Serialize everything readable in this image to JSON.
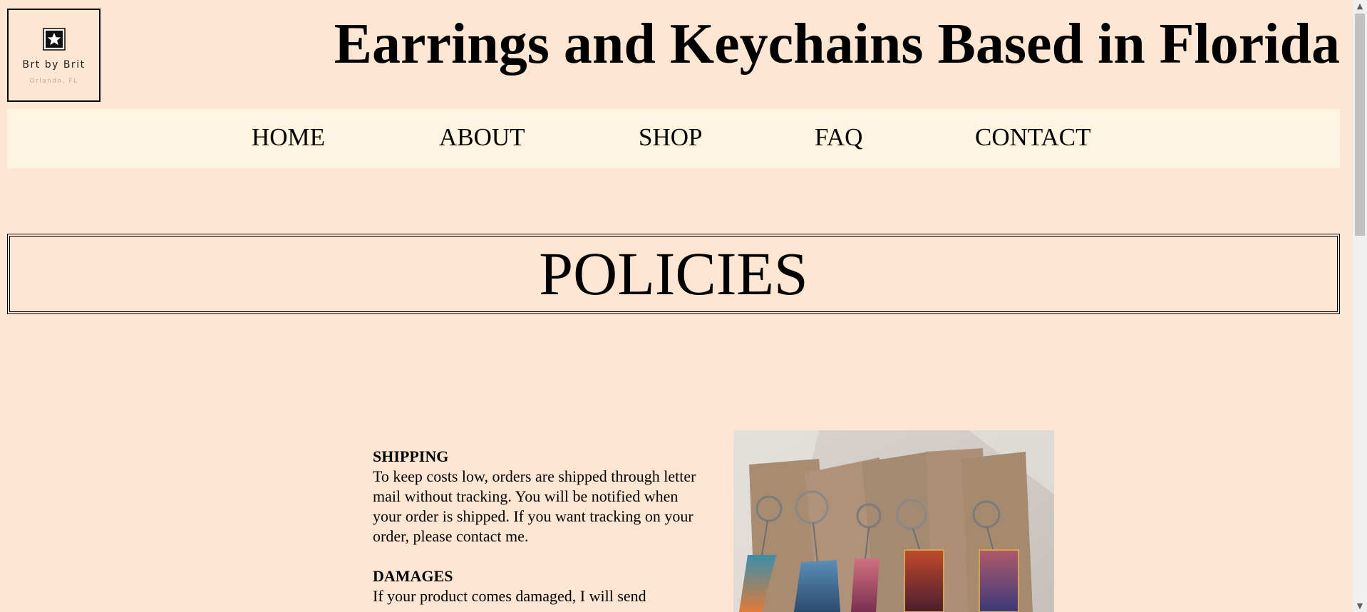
{
  "header": {
    "logo": {
      "name": "Brt by Brit",
      "location": "Orlando, FL",
      "icon": "star-icon"
    },
    "title": "Earrings and Keychains Based in Florida"
  },
  "nav": {
    "items": [
      {
        "label": "HOME"
      },
      {
        "label": "ABOUT"
      },
      {
        "label": "SHOP"
      },
      {
        "label": "FAQ"
      },
      {
        "label": "CONTACT"
      }
    ]
  },
  "banner": {
    "title": "POLICIES"
  },
  "policies": [
    {
      "heading": "SHIPPING",
      "body": "To keep costs low, orders are shipped through letter mail without tracking. You will be notified when your order is shipped. If you want tracking on your order, please contact me."
    },
    {
      "heading": "DAMAGES",
      "body": "If your product comes damaged, I will send"
    }
  ],
  "image": {
    "subject": "keychains-photo"
  },
  "colors": {
    "page_background": "#ffe6d2",
    "nav_background": "#fff5e1",
    "text": "#000000"
  }
}
